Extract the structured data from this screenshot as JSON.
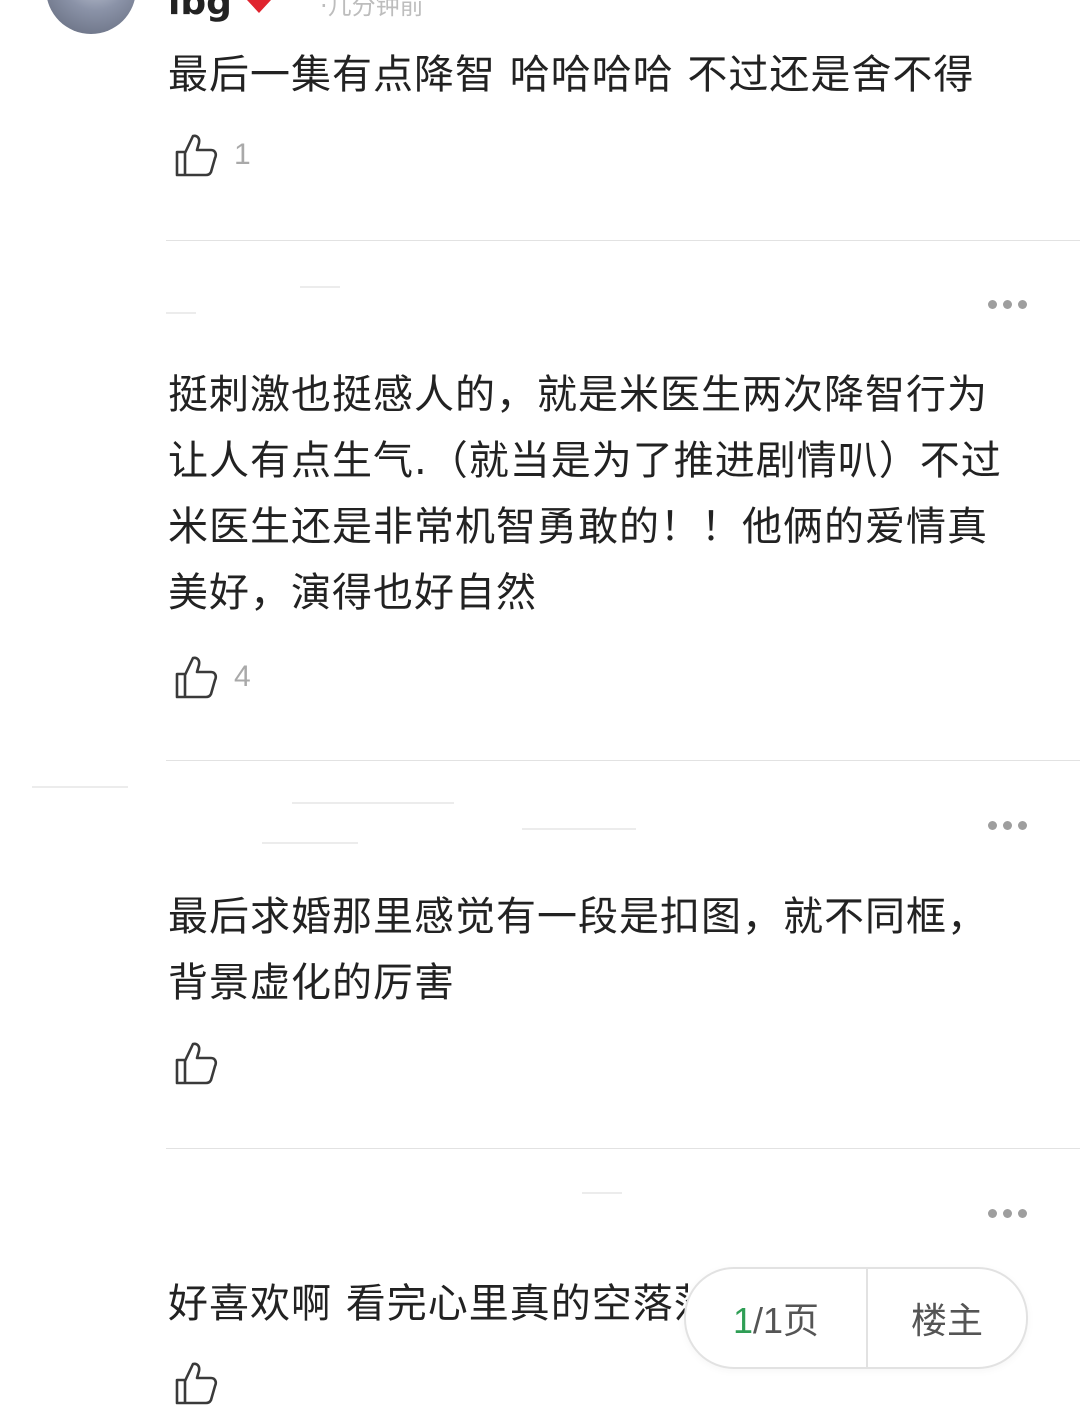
{
  "top_comment": {
    "author": "lbg",
    "meta": "·几分钟前",
    "text": "最后一集有点降智 哈哈哈哈 不过还是舍不得",
    "likes": "1"
  },
  "comments": [
    {
      "text": "挺刺激也挺感人的，就是米医生两次降智行为让人有点生气.（就当是为了推进剧情叭）不过米医生还是非常机智勇敢的！！他俩的爱情真美好，演得也好自然",
      "likes": "4"
    },
    {
      "text": "最后求婚那里感觉有一段是扣图，就不同框，背景虚化的厉害",
      "likes": ""
    },
    {
      "text": "好喜欢啊 看完心里真的空落落的",
      "likes": ""
    }
  ],
  "pager": {
    "current": "1",
    "total": "/1页",
    "op_label": "楼主"
  },
  "colors": {
    "accent": "#2f9e55",
    "heart": "#e0242f"
  }
}
